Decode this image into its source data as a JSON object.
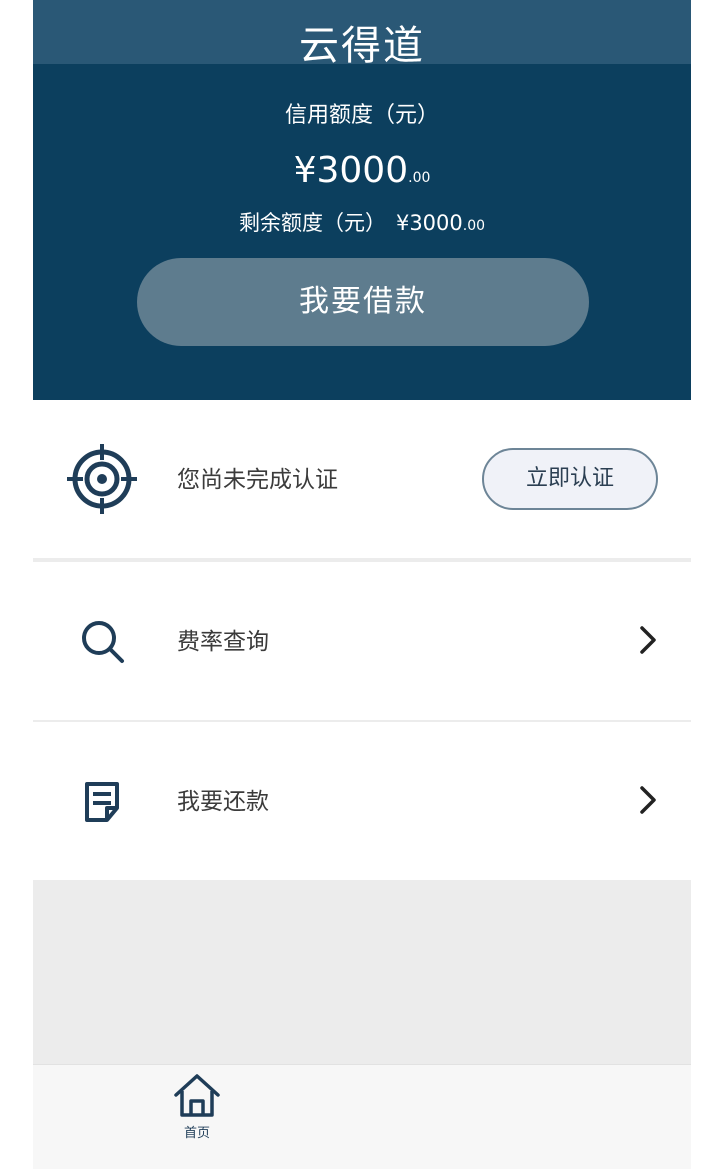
{
  "app": {
    "title": "云得道"
  },
  "credit": {
    "label": "信用额度（元）",
    "amount": "¥3000",
    "amount_cents": ".00",
    "remaining_label": "剩余额度（元）",
    "remaining_amount": "¥3000",
    "remaining_cents": ".00"
  },
  "actions": {
    "borrow_label": "我要借款"
  },
  "list": {
    "verify_status": "您尚未完成认证",
    "verify_button": "立即认证",
    "rate_query": "费率查询",
    "repay": "我要还款"
  },
  "tabbar": {
    "home_label": "首页"
  },
  "colors": {
    "header_bg": "#0c3f5e",
    "button_bg": "#5e7c8e",
    "icon": "#1f3d58"
  }
}
